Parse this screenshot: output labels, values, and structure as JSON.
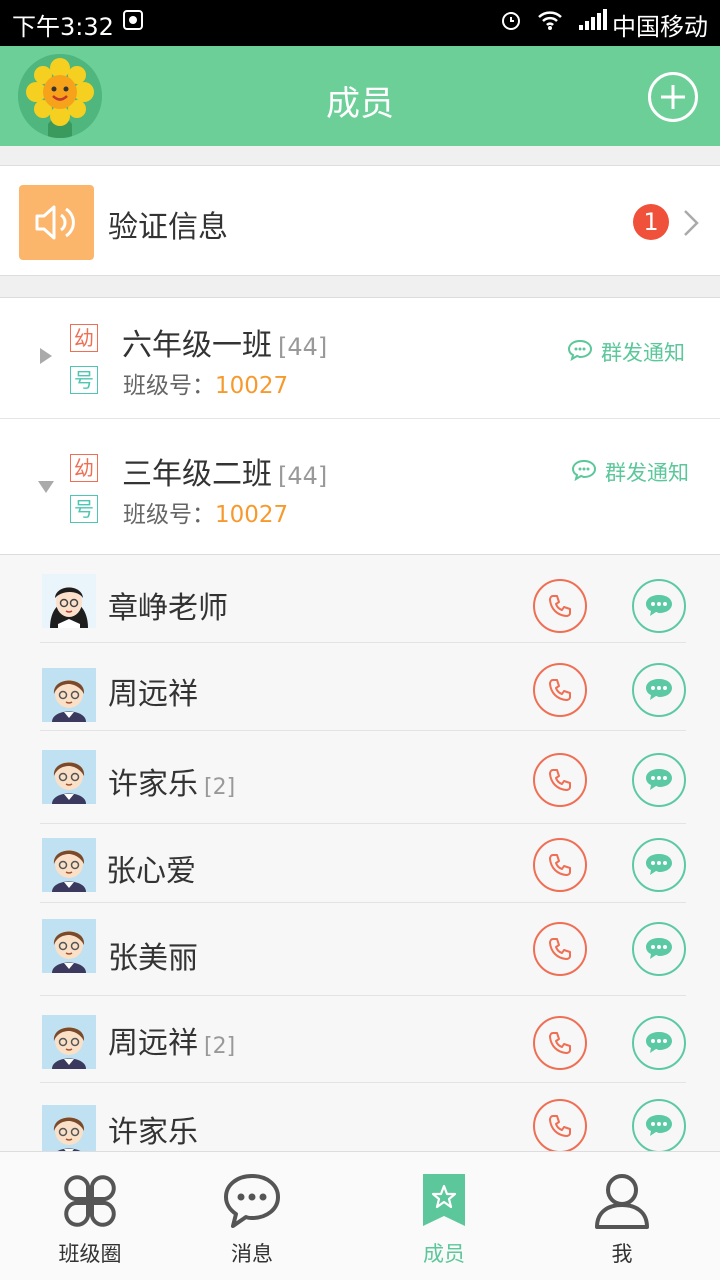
{
  "status_bar": {
    "time": "下午3:32",
    "carrier": "中国移动"
  },
  "header": {
    "title": "成员"
  },
  "verify": {
    "label": "验证信息",
    "badge": "1"
  },
  "classes": [
    {
      "name": "六年级一班",
      "count": "[44]",
      "tag1": "幼",
      "tag2": "号",
      "num_label": "班级号：",
      "num": "10027",
      "notify": "群发通知",
      "expanded": false
    },
    {
      "name": "三年级二班",
      "count": "[44]",
      "tag1": "幼",
      "tag2": "号",
      "num_label": "班级号：",
      "num": "10027",
      "notify": "群发通知",
      "expanded": true
    }
  ],
  "members": [
    {
      "name": "章峥老师",
      "count": "",
      "avatar": "teacher-avatar"
    },
    {
      "name": "周远祥",
      "count": "",
      "avatar": "student-avatar"
    },
    {
      "name": "许家乐",
      "count": "[2]",
      "avatar": "student-avatar"
    },
    {
      "name": "张心爱",
      "count": "",
      "avatar": "student-avatar"
    },
    {
      "name": "张美丽",
      "count": "",
      "avatar": "student-avatar"
    },
    {
      "name": "周远祥",
      "count": "[2]",
      "avatar": "student-avatar"
    },
    {
      "name": "许家乐",
      "count": "",
      "avatar": "student-avatar"
    }
  ],
  "nav": [
    {
      "label": "班级圈",
      "icon": "clover-icon",
      "active": false
    },
    {
      "label": "消息",
      "icon": "chat-bubble-icon",
      "active": false
    },
    {
      "label": "成员",
      "icon": "star-bookmark-icon",
      "active": true
    },
    {
      "label": "我",
      "icon": "user-icon",
      "active": false
    }
  ],
  "colors": {
    "primary_green": "#6ccf98",
    "call_red": "#ef6f54",
    "msg_green": "#5cc9a5",
    "badge_red": "#f0513a",
    "number_orange": "#f79a2e"
  }
}
